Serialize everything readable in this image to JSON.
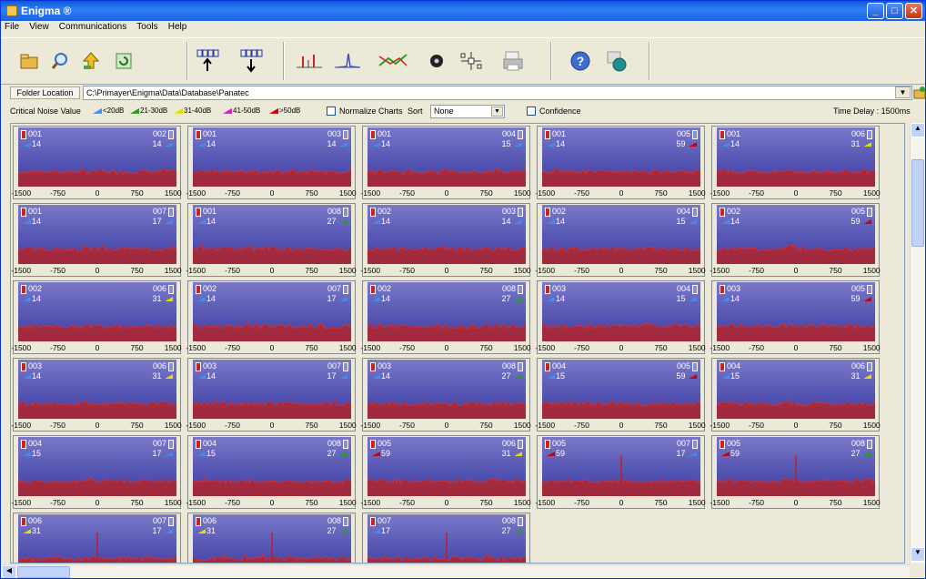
{
  "window": {
    "title": "Enigma ®"
  },
  "menu": [
    "File",
    "View",
    "Communications",
    "Tools",
    "Help"
  ],
  "toolbar": {
    "icons": [
      "folder-open-icon",
      "magnifier-icon",
      "upload-icon",
      "refresh-icon",
      "send-data-icon",
      "receive-data-icon",
      "dual-chart-icon",
      "single-spike-chart-icon",
      "correlation-chart-icon",
      "disc-icon",
      "network-icon",
      "print-icon",
      "help-icon",
      "globe-icon"
    ]
  },
  "folder": {
    "label": "Folder Location",
    "path": "C:\\Primayer\\Enigma\\Data\\Database\\Panatec"
  },
  "options": {
    "critical_label": "Critical Noise Value",
    "noise_levels": [
      {
        "label": "<20dB",
        "color": "#3d8ef0"
      },
      {
        "label": "21-30dB",
        "color": "#1ea31e"
      },
      {
        "label": "31-40dB",
        "color": "#e3e000"
      },
      {
        "label": "41-50dB",
        "color": "#d21fc0"
      },
      {
        "label": ">50dB",
        "color": "#d00000"
      }
    ],
    "normalize_label": "Normalize Charts",
    "sort_label": "Sort",
    "sort_value": "None",
    "confidence_label": "Confidence",
    "time_delay": "Time Delay : 1500ms"
  },
  "x_ticks": [
    "-1500",
    "-750",
    "0",
    "750",
    "1500"
  ],
  "colors": {
    "blue": "#3d8ef0",
    "green": "#1ea31e",
    "yellow": "#e3e000",
    "red": "#d00000"
  },
  "charts": [
    {
      "left": "001",
      "right": "002",
      "lv": "14",
      "rv": "14",
      "lc": "blue",
      "rc": "blue",
      "spike": null
    },
    {
      "left": "001",
      "right": "003",
      "lv": "14",
      "rv": "14",
      "lc": "blue",
      "rc": "blue",
      "spike": null
    },
    {
      "left": "001",
      "right": "004",
      "lv": "14",
      "rv": "15",
      "lc": "blue",
      "rc": "blue",
      "spike": null
    },
    {
      "left": "001",
      "right": "005",
      "lv": "14",
      "rv": "59",
      "lc": "blue",
      "rc": "red",
      "spike": null
    },
    {
      "left": "001",
      "right": "006",
      "lv": "14",
      "rv": "31",
      "lc": "blue",
      "rc": "yellow",
      "spike": null
    },
    {
      "left": "001",
      "right": "007",
      "lv": "14",
      "rv": "17",
      "lc": "blue",
      "rc": "blue",
      "spike": null
    },
    {
      "left": "001",
      "right": "008",
      "lv": "14",
      "rv": "27",
      "lc": "blue",
      "rc": "green",
      "spike": null
    },
    {
      "left": "002",
      "right": "003",
      "lv": "14",
      "rv": "14",
      "lc": "blue",
      "rc": "blue",
      "spike": null
    },
    {
      "left": "002",
      "right": "004",
      "lv": "14",
      "rv": "15",
      "lc": "blue",
      "rc": "blue",
      "spike": null
    },
    {
      "left": "002",
      "right": "005",
      "lv": "14",
      "rv": "59",
      "lc": "blue",
      "rc": "red",
      "spike": null
    },
    {
      "left": "002",
      "right": "006",
      "lv": "14",
      "rv": "31",
      "lc": "blue",
      "rc": "yellow",
      "spike": null
    },
    {
      "left": "002",
      "right": "007",
      "lv": "14",
      "rv": "17",
      "lc": "blue",
      "rc": "blue",
      "spike": null
    },
    {
      "left": "002",
      "right": "008",
      "lv": "14",
      "rv": "27",
      "lc": "blue",
      "rc": "green",
      "spike": null
    },
    {
      "left": "003",
      "right": "004",
      "lv": "14",
      "rv": "15",
      "lc": "blue",
      "rc": "blue",
      "spike": null
    },
    {
      "left": "003",
      "right": "005",
      "lv": "14",
      "rv": "59",
      "lc": "blue",
      "rc": "red",
      "spike": null
    },
    {
      "left": "003",
      "right": "006",
      "lv": "14",
      "rv": "31",
      "lc": "blue",
      "rc": "yellow",
      "spike": null
    },
    {
      "left": "003",
      "right": "007",
      "lv": "14",
      "rv": "17",
      "lc": "blue",
      "rc": "blue",
      "spike": null
    },
    {
      "left": "003",
      "right": "008",
      "lv": "14",
      "rv": "27",
      "lc": "blue",
      "rc": "green",
      "spike": null
    },
    {
      "left": "004",
      "right": "005",
      "lv": "15",
      "rv": "59",
      "lc": "blue",
      "rc": "red",
      "spike": null
    },
    {
      "left": "004",
      "right": "006",
      "lv": "15",
      "rv": "31",
      "lc": "blue",
      "rc": "yellow",
      "spike": null
    },
    {
      "left": "004",
      "right": "007",
      "lv": "15",
      "rv": "17",
      "lc": "blue",
      "rc": "blue",
      "spike": null
    },
    {
      "left": "004",
      "right": "008",
      "lv": "15",
      "rv": "27",
      "lc": "blue",
      "rc": "green",
      "spike": null
    },
    {
      "left": "005",
      "right": "006",
      "lv": "59",
      "rv": "31",
      "lc": "red",
      "rc": "yellow",
      "spike": null
    },
    {
      "left": "005",
      "right": "007",
      "lv": "59",
      "rv": "17",
      "lc": "red",
      "rc": "blue",
      "spike": 0
    },
    {
      "left": "005",
      "right": "008",
      "lv": "59",
      "rv": "27",
      "lc": "red",
      "rc": "green",
      "spike": 0
    },
    {
      "left": "006",
      "right": "007",
      "lv": "31",
      "rv": "17",
      "lc": "yellow",
      "rc": "blue",
      "spike": 0
    },
    {
      "left": "006",
      "right": "008",
      "lv": "31",
      "rv": "27",
      "lc": "yellow",
      "rc": "green",
      "spike": 0
    },
    {
      "left": "007",
      "right": "008",
      "lv": "17",
      "rv": "27",
      "lc": "blue",
      "rc": "green",
      "spike": 0
    }
  ]
}
